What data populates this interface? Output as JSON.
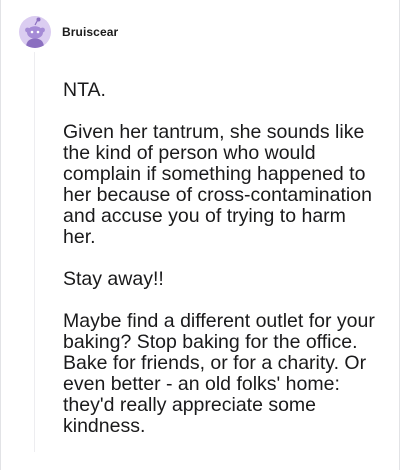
{
  "comment": {
    "username": "Bruiscear",
    "avatar_icon": "snoo-avatar-icon",
    "avatar_color": "#dbcdf1",
    "paragraphs": [
      "NTA.",
      "Given her tantrum, she sounds like the kind of person who would complain if something happened to her because of cross-contamination and accuse you of trying to harm her.",
      "Stay away!!",
      "Maybe find a different outlet for your baking? Stop baking for the office. Bake for friends, or for a charity. Or even better - an old folks' home: they'd really appreciate some kindness."
    ]
  }
}
